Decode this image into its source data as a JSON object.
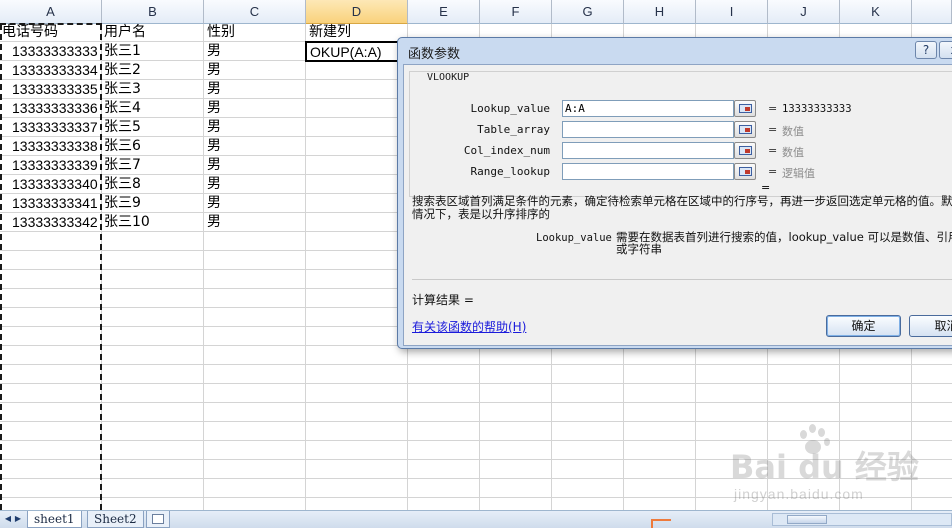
{
  "spreadsheet": {
    "columns": [
      "A",
      "B",
      "C",
      "D",
      "E",
      "F",
      "G",
      "H",
      "I",
      "J",
      "K"
    ],
    "selected_column": "D",
    "headers": {
      "A": "电话号码",
      "B": "用户名",
      "C": "性别",
      "D": "新建列"
    },
    "rows": [
      {
        "phone": "13333333333",
        "name": "张三1",
        "gender": "男"
      },
      {
        "phone": "13333333334",
        "name": "张三2",
        "gender": "男"
      },
      {
        "phone": "13333333335",
        "name": "张三3",
        "gender": "男"
      },
      {
        "phone": "13333333336",
        "name": "张三4",
        "gender": "男"
      },
      {
        "phone": "13333333337",
        "name": "张三5",
        "gender": "男"
      },
      {
        "phone": "13333333338",
        "name": "张三6",
        "gender": "男"
      },
      {
        "phone": "13333333339",
        "name": "张三7",
        "gender": "男"
      },
      {
        "phone": "13333333340",
        "name": "张三8",
        "gender": "男"
      },
      {
        "phone": "13333333341",
        "name": "张三9",
        "gender": "男"
      },
      {
        "phone": "13333333342",
        "name": "张三10",
        "gender": "男"
      }
    ],
    "active_cell_text": "OKUP(A:A)"
  },
  "sheet_tabs": {
    "tabs": [
      "sheet1",
      "Sheet2"
    ],
    "active_tab": "sheet1"
  },
  "dialog": {
    "title": "函数参数",
    "help_button": "?",
    "close_button": "x",
    "function_name": "VLOOKUP",
    "arguments": [
      {
        "label": "Lookup_value",
        "value": "A:A",
        "result": "13333333333",
        "result_placeholder": false
      },
      {
        "label": "Table_array",
        "value": "",
        "result": "数值",
        "result_placeholder": true
      },
      {
        "label": "Col_index_num",
        "value": "",
        "result": "数值",
        "result_placeholder": true
      },
      {
        "label": "Range_lookup",
        "value": "",
        "result": "逻辑值",
        "result_placeholder": true
      }
    ],
    "equals_sign": "=",
    "overall_equals": "=",
    "description": "搜索表区域首列满足条件的元素，确定待检索单元格在区域中的行序号，再进一步返回选定单元格的值。默认情况下，表是以升序排序的",
    "arg_desc_name": "Lookup_value",
    "arg_desc_text": "需要在数据表首列进行搜索的值，lookup_value 可以是数值、引用或字符串",
    "calc_result_label": "计算结果 =",
    "help_link": "有关该函数的帮助(H)",
    "ok_label": "确定",
    "cancel_label": "取消"
  },
  "watermark": {
    "brand": "Bai du 经验",
    "url": "jingyan.baidu.com"
  }
}
